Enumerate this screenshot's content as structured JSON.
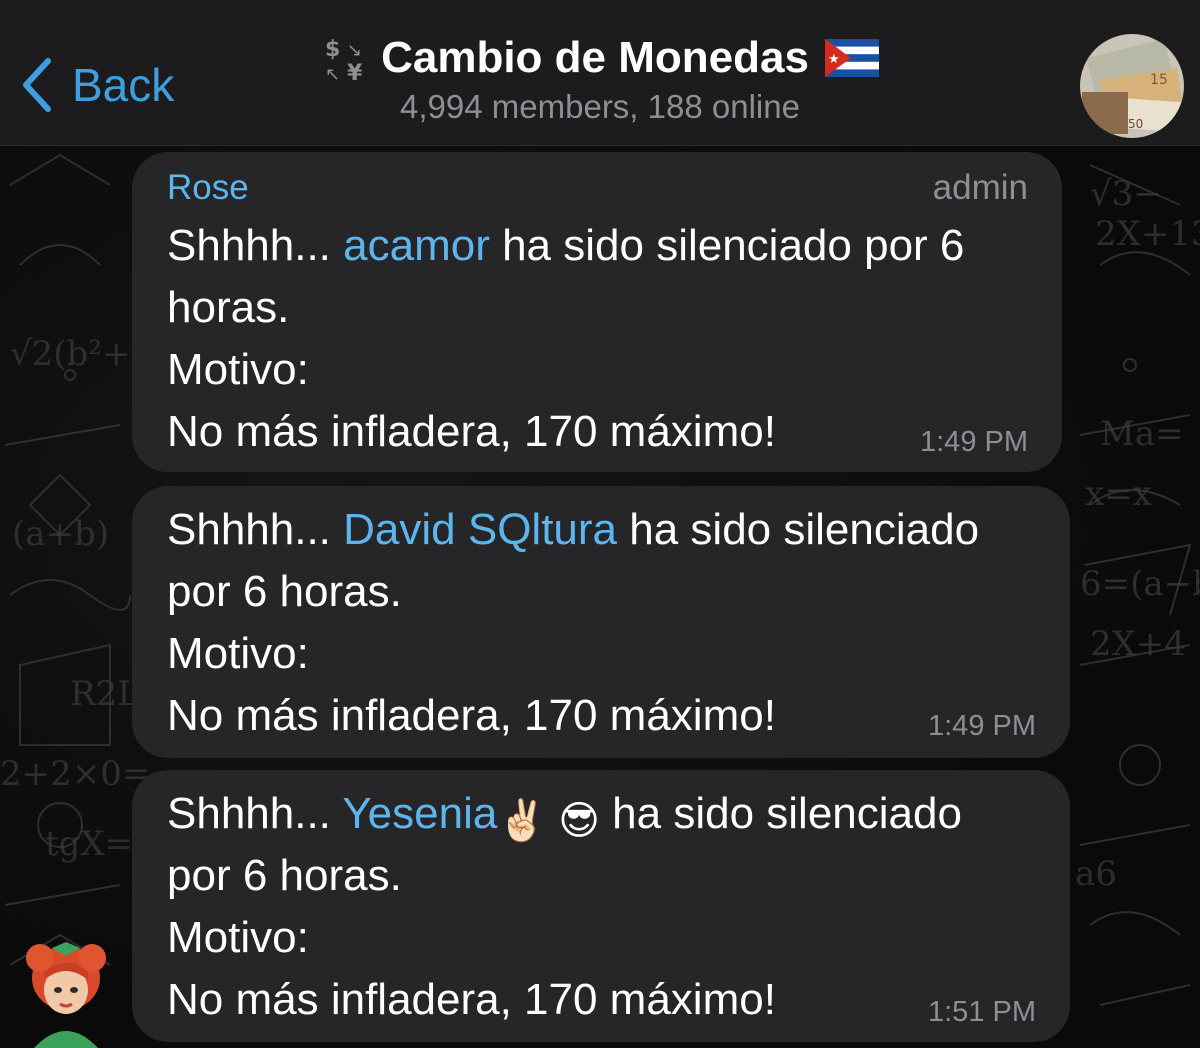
{
  "header": {
    "back_label": "Back",
    "title": "Cambio de Monedas",
    "subtitle": "4,994 members, 188 online",
    "exchange_icon_glyphs": "$¥",
    "flag": "cuba-flag-icon"
  },
  "messages": [
    {
      "sender": "Rose",
      "role": "admin",
      "line1_prefix": "Shhhh... ",
      "mention": "acamor",
      "line1_suffix": " ha sido silenciado por 6",
      "line2": "horas.",
      "line3": "Motivo:",
      "line4": "No más infladera, 170 máximo!",
      "time": "1:49 PM"
    },
    {
      "line1_prefix": "Shhhh... ",
      "mention": "David SQltura",
      "line1_suffix": " ha sido silenciado",
      "line2": "por 6 horas.",
      "line3": "Motivo:",
      "line4": "No más infladera, 170 máximo!",
      "time": "1:49 PM"
    },
    {
      "line1_prefix": "Shhhh... ",
      "mention": "Yesenia",
      "mention_emoji": "✌🏻 😎",
      "line1_suffix": " ha sido silenciado",
      "line2": "por 6 horas.",
      "line3": "Motivo:",
      "line4": "No más infladera, 170 máximo!",
      "time": "1:51 PM"
    }
  ],
  "colors": {
    "accent": "#3e9fe0",
    "mention": "#5db5ee",
    "bubble": "#262628",
    "header": "#1c1c1e",
    "muted": "#8e8e93"
  }
}
